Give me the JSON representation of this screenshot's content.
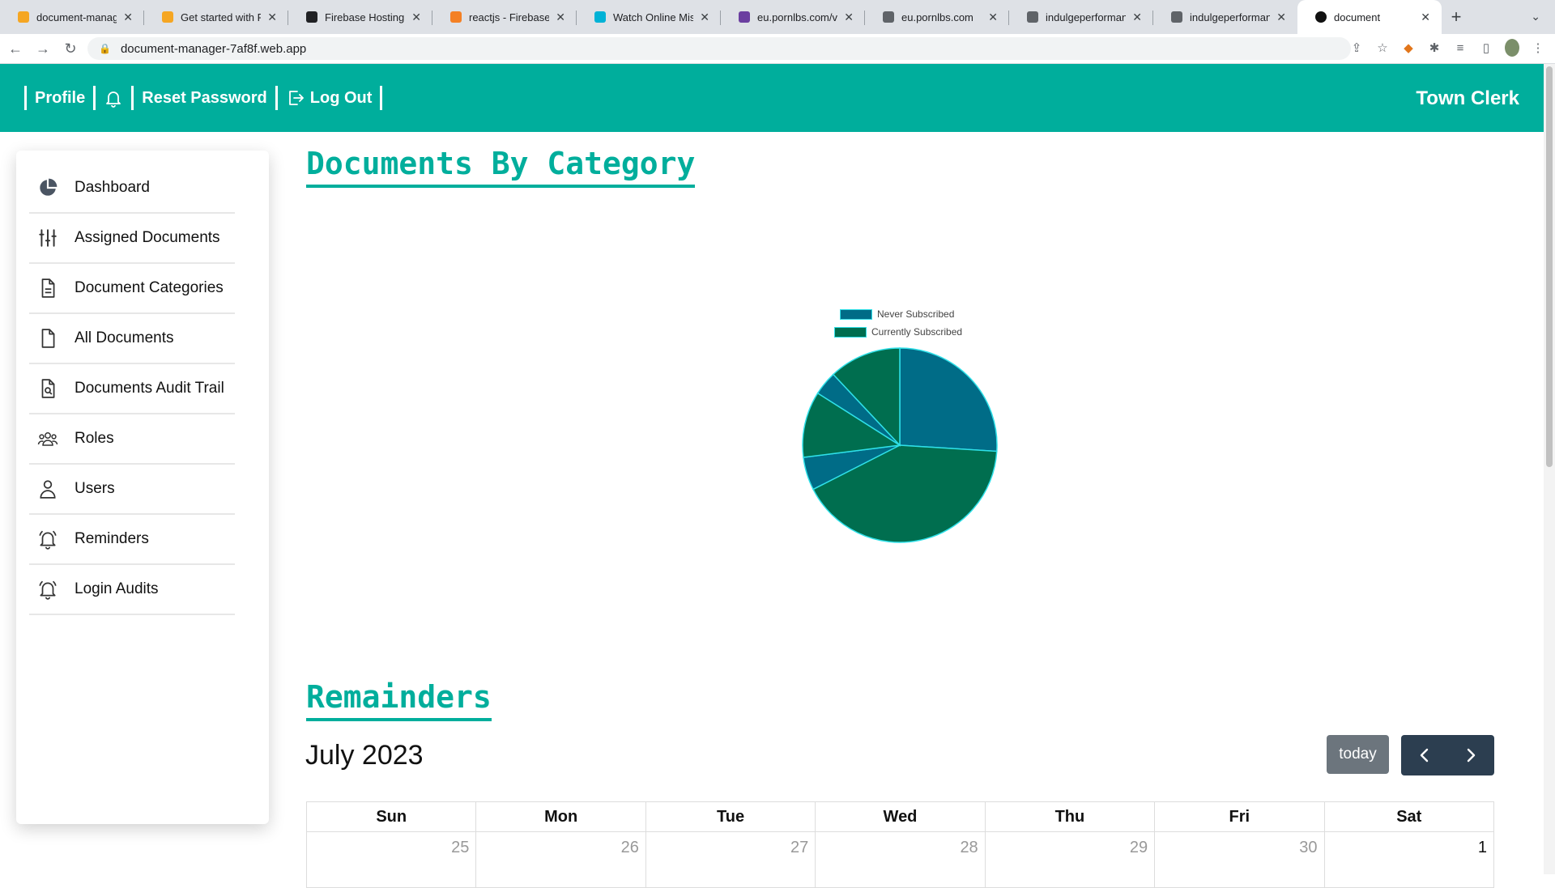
{
  "browser": {
    "tabs": [
      {
        "title": "document-manager",
        "favicon_color": "#f5a623"
      },
      {
        "title": "Get started with Fire",
        "favicon_color": "#f5a623"
      },
      {
        "title": "Firebase Hosting - V",
        "favicon_color": "#202124"
      },
      {
        "title": "reactjs - Firebase Ho",
        "favicon_color": "#f48024"
      },
      {
        "title": "Watch Online Missio",
        "favicon_color": "#00b2d6"
      },
      {
        "title": "eu.pornlbs.com/view",
        "favicon_color": "#6b3fa0"
      },
      {
        "title": "eu.pornlbs.com",
        "favicon_color": "#5f6368"
      },
      {
        "title": "indulgeperformance",
        "favicon_color": "#5f6368"
      },
      {
        "title": "indulgeperformance",
        "favicon_color": "#5f6368"
      },
      {
        "title": "document",
        "favicon_color": "#111111",
        "active": true
      }
    ],
    "url": "document-manager-7af8f.web.app"
  },
  "header": {
    "nav": [
      {
        "label": "Profile"
      },
      {
        "label": ""
      },
      {
        "label": "Reset Password"
      },
      {
        "label": "Log Out"
      }
    ],
    "brand": "Town Clerk",
    "color": "#00ae9c"
  },
  "sidebar": {
    "items": [
      {
        "label": "Dashboard",
        "icon": "pie-chart-icon"
      },
      {
        "label": "Assigned Documents",
        "icon": "sliders-icon"
      },
      {
        "label": "Document Categories",
        "icon": "document-text-icon"
      },
      {
        "label": "All Documents",
        "icon": "document-icon"
      },
      {
        "label": "Documents Audit Trail",
        "icon": "document-search-icon"
      },
      {
        "label": "Roles",
        "icon": "people-icon"
      },
      {
        "label": "Users",
        "icon": "person-icon"
      },
      {
        "label": "Reminders",
        "icon": "bell-icon"
      },
      {
        "label": "Login Audits",
        "icon": "bell-icon"
      }
    ]
  },
  "main": {
    "chart_section_title": "Documents By Category",
    "reminders_title": "Remainders"
  },
  "chart_data": {
    "type": "pie",
    "legend": [
      "Never Subscribed",
      "Currently Subscribed"
    ],
    "legend_placement": "top",
    "colors": [
      "#006c87",
      "#006e4f"
    ],
    "border_color": "#2fe0e8",
    "values": [
      26.0,
      41.5,
      5.5,
      11.0,
      4.0,
      12.0
    ],
    "slice_colors": [
      "#006c87",
      "#006e4f",
      "#006c87",
      "#006e4f",
      "#006c87",
      "#006e4f"
    ]
  },
  "calendar": {
    "title": "July 2023",
    "today_label": "today",
    "weekdays": [
      "Sun",
      "Mon",
      "Tue",
      "Wed",
      "Thu",
      "Fri",
      "Sat"
    ],
    "first_week": [
      {
        "day": "25",
        "other": true
      },
      {
        "day": "26",
        "other": true
      },
      {
        "day": "27",
        "other": true
      },
      {
        "day": "28",
        "other": true
      },
      {
        "day": "29",
        "other": true
      },
      {
        "day": "30",
        "other": true
      },
      {
        "day": "1",
        "other": false
      }
    ]
  }
}
